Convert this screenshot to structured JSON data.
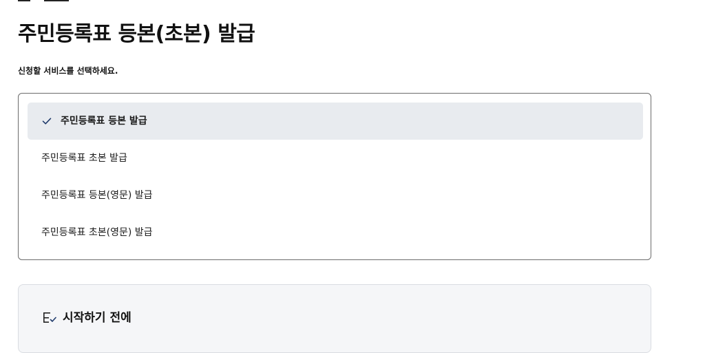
{
  "page": {
    "title": "주민등록표 등본(초본) 발급",
    "instruction": "신청할 서비스를 선택하세요."
  },
  "service_options": {
    "selected_index": 0,
    "items": [
      {
        "label": "주민등록표 등본 발급",
        "selected": true
      },
      {
        "label": "주민등록표 초본 발급",
        "selected": false
      },
      {
        "label": "주민등록표 등본(영문) 발급",
        "selected": false
      },
      {
        "label": "주민등록표 초본(영문) 발급",
        "selected": false
      }
    ]
  },
  "info_panel": {
    "title": "시작하기 전에",
    "icon": "checklist-icon"
  },
  "colors": {
    "selected_bg": "#e8ebef",
    "check": "#1f3a6b",
    "border": "#6b6b6b",
    "panel_bg": "#f5f6f8"
  }
}
